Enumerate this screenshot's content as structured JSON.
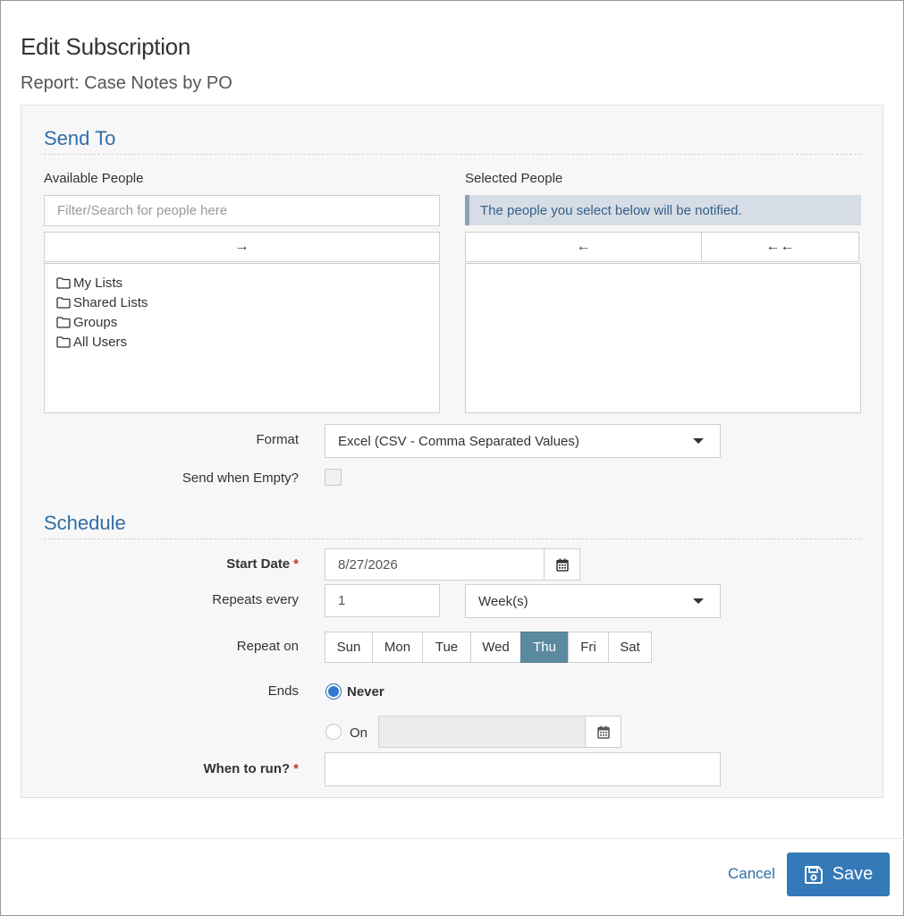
{
  "modal": {
    "title": "Edit Subscription",
    "subtitle": "Report: Case Notes by PO"
  },
  "send_to": {
    "heading": "Send To",
    "available_label": "Available People",
    "search_placeholder": "Filter/Search for people here",
    "add_arrow": "→",
    "tree": [
      {
        "label": "My Lists",
        "icon": "folder-icon"
      },
      {
        "label": "Shared Lists",
        "icon": "folder-icon"
      },
      {
        "label": "Groups",
        "icon": "folder-icon"
      },
      {
        "label": "All Users",
        "icon": "folder-icon"
      }
    ],
    "selected_label": "Selected People",
    "selected_info": "The people you select below will be notified.",
    "remove_arrow": "←",
    "remove_all_arrow": "←←"
  },
  "format": {
    "label": "Format",
    "value": "Excel (CSV - Comma Separated Values)"
  },
  "send_when_empty": {
    "label": "Send when Empty?",
    "checked": false
  },
  "schedule": {
    "heading": "Schedule",
    "start_date_label": "Start Date",
    "required_mark": "*",
    "start_date_value": "8/27/2026",
    "repeats_label": "Repeats every",
    "repeats_value": "1",
    "repeats_unit": "Week(s)",
    "repeat_on_label": "Repeat on",
    "days": [
      {
        "label": "Sun",
        "active": false
      },
      {
        "label": "Mon",
        "active": false
      },
      {
        "label": "Tue",
        "active": false
      },
      {
        "label": "Wed",
        "active": false
      },
      {
        "label": "Thu",
        "active": true
      },
      {
        "label": "Fri",
        "active": false
      },
      {
        "label": "Sat",
        "active": false
      }
    ],
    "ends_label": "Ends",
    "ends_never": "Never",
    "ends_on": "On",
    "when_to_run_label": "When to run?"
  },
  "footer": {
    "cancel_label": "Cancel",
    "save_label": "Save"
  },
  "colors": {
    "accent": "#2f6da7",
    "primary_button": "#3479b8",
    "active_day": "#5b8aa0"
  }
}
